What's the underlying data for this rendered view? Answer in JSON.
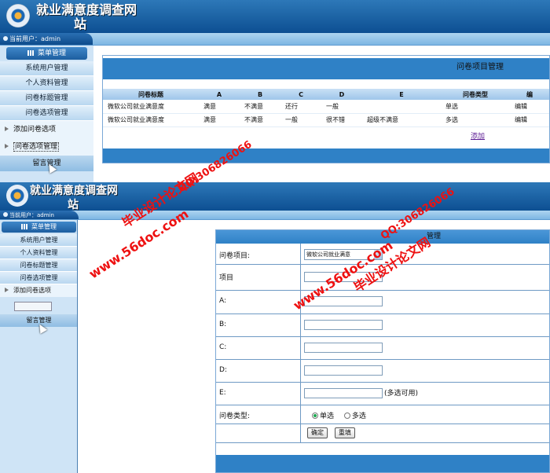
{
  "site": {
    "title_line1": "就业满意度调查网",
    "title_line2": "站"
  },
  "user": {
    "label": "当前用户：admin"
  },
  "menu": {
    "head": "菜单管理",
    "items": [
      "系统用户管理",
      "个人资料管理",
      "问卷标题管理",
      "问卷选项管理"
    ],
    "sub_items": [
      "添加问卷选项",
      "问卷选项管理"
    ],
    "message": "留言管理"
  },
  "list_panel": {
    "title": "问卷项目管理",
    "columns": [
      "问卷标题",
      "A",
      "B",
      "C",
      "D",
      "E",
      "问卷类型",
      "编"
    ],
    "rows": [
      [
        "微软公司就业满意度",
        "满意",
        "不满意",
        "还行",
        "一般",
        "",
        "单选",
        "编辑"
      ],
      [
        "微软公司就业满意度",
        "满意",
        "不满意",
        "一般",
        "很不错",
        "超级不满意",
        "多选",
        "编辑"
      ]
    ],
    "add_link": "添加"
  },
  "form_panel": {
    "title": "管理",
    "survey_label": "问卷项目:",
    "survey_selected": "微软公司就业满意",
    "item_label": "项目",
    "a_label": "A:",
    "b_label": "B:",
    "c_label": "C:",
    "d_label": "D:",
    "e_label": "E:",
    "e_hint": "(多选可用)",
    "type_label": "问卷类型:",
    "radio_single": "单选",
    "radio_multi": "多选",
    "submit": "确定",
    "reset": "重填"
  },
  "watermarks": [
    "毕业设计论文网",
    "www.56doc.com",
    "QQ:306826066"
  ]
}
